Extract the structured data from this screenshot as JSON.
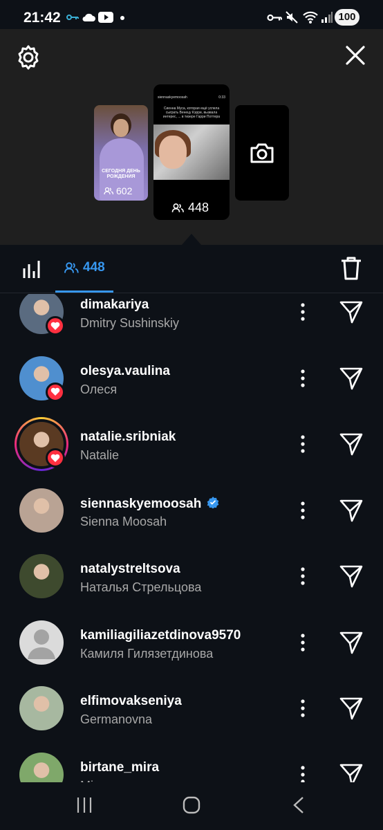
{
  "status_bar": {
    "time": "21:42",
    "battery": "100",
    "icons": [
      "key-icon",
      "cloud-icon",
      "youtube-icon",
      "dot-icon",
      "vpn-key-icon",
      "mute-icon",
      "wifi-icon",
      "signal-icon"
    ]
  },
  "stories": {
    "left": {
      "caption": "СЕГОДНЯ ДЕНЬ РОЖДЕНИЯ",
      "viewers": "602"
    },
    "center": {
      "header": "siennaskyemoosah",
      "time": "0:33",
      "text": "Сиенна Муса, которая ещё успела сыграть Венецу Кэрри, вызвала интерес, ... в тизере Гарри Поттера",
      "viewers": "448"
    },
    "right": {
      "icon": "camera-icon"
    }
  },
  "tabs": {
    "viewers_count": "448"
  },
  "viewers": [
    {
      "username": "dimakariya",
      "fullname": "Dmitry Sushinskiy",
      "liked": true,
      "verified": false,
      "story_ring": false,
      "avatar_color": "#5a6b80"
    },
    {
      "username": "olesya.vaulina",
      "fullname": "Олеся",
      "liked": true,
      "verified": false,
      "story_ring": false,
      "avatar_color": "#4f8fcf"
    },
    {
      "username": "natalie.sribniak",
      "fullname": "Natalie",
      "liked": true,
      "verified": false,
      "story_ring": true,
      "avatar_color": "#5a3a22"
    },
    {
      "username": "siennaskyemoosah",
      "fullname": "Sienna Moosah",
      "liked": false,
      "verified": true,
      "story_ring": false,
      "avatar_color": "#b9a394"
    },
    {
      "username": "natalystreltsova",
      "fullname": "Наталья Стрельцова",
      "liked": false,
      "verified": false,
      "story_ring": false,
      "avatar_color": "#3e4a2e"
    },
    {
      "username": "kamiliagiliazetdinova9570",
      "fullname": "Камиля Гилязетдинова",
      "liked": false,
      "verified": false,
      "story_ring": false,
      "avatar_color": "default"
    },
    {
      "username": "elfimovakseniya",
      "fullname": "Germanovna",
      "liked": false,
      "verified": false,
      "story_ring": false,
      "avatar_color": "#a7b8a0"
    },
    {
      "username": "birtane_mira",
      "fullname": "Mira",
      "liked": false,
      "verified": false,
      "story_ring": false,
      "avatar_color": "#7fa86a"
    }
  ],
  "colors": {
    "accent": "#3797ef",
    "like": "#ff3040",
    "background": "#0d1117",
    "header_bg": "#1f1f1f"
  }
}
